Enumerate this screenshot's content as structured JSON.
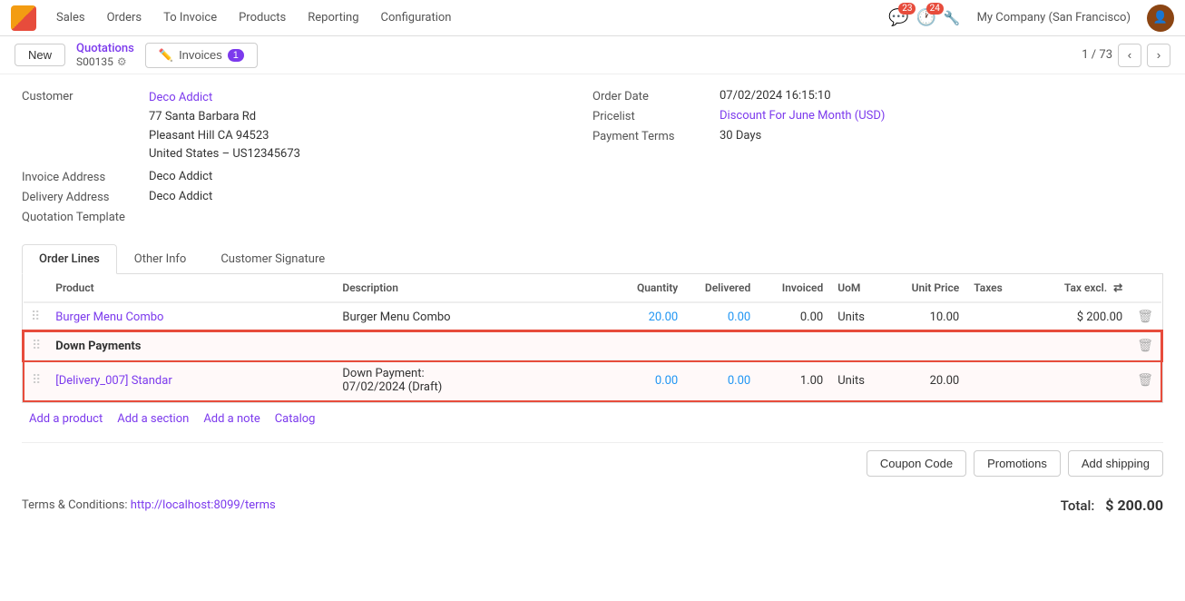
{
  "topnav": {
    "app_name": "Sales",
    "items": [
      "Orders",
      "To Invoice",
      "Products",
      "Reporting",
      "Configuration"
    ],
    "badge_msg": "23",
    "badge_clock": "24",
    "company": "My Company (San Francisco)"
  },
  "action_bar": {
    "new_label": "New",
    "breadcrumb_parent": "Quotations",
    "record_id": "S00135",
    "invoice_label": "Invoices",
    "invoice_count": "1",
    "pagination": "1 / 73"
  },
  "form": {
    "customer_label": "Customer",
    "customer_name": "Deco Addict",
    "customer_address1": "77 Santa Barbara Rd",
    "customer_address2": "Pleasant Hill CA 94523",
    "customer_address3": "United States – US12345673",
    "order_date_label": "Order Date",
    "order_date": "07/02/2024 16:15:10",
    "pricelist_label": "Pricelist",
    "pricelist_value": "Discount For June Month (USD)",
    "payment_terms_label": "Payment Terms",
    "payment_terms_value": "30 Days",
    "invoice_address_label": "Invoice Address",
    "invoice_address_value": "Deco Addict",
    "delivery_address_label": "Delivery Address",
    "delivery_address_value": "Deco Addict",
    "quotation_template_label": "Quotation Template"
  },
  "tabs": {
    "items": [
      "Order Lines",
      "Other Info",
      "Customer Signature"
    ],
    "active": 0
  },
  "table": {
    "headers": [
      "",
      "Product",
      "Description",
      "Quantity",
      "Delivered",
      "Invoiced",
      "UoM",
      "Unit Price",
      "Taxes",
      "Tax excl.",
      ""
    ],
    "rows": [
      {
        "type": "product",
        "product": "Burger Menu Combo",
        "description": "Burger Menu Combo",
        "quantity": "20.00",
        "delivered": "0.00",
        "invoiced": "0.00",
        "uom": "Units",
        "unit_price": "10.00",
        "taxes": "",
        "tax_excl": "$ 200.00"
      }
    ],
    "section_rows": [
      {
        "type": "section",
        "label": "Down Payments"
      }
    ],
    "down_payment_rows": [
      {
        "type": "product",
        "product": "[Delivery_007] Standar",
        "description": "Down Payment:\n07/02/2024 (Draft)",
        "quantity": "0.00",
        "delivered": "0.00",
        "invoiced": "1.00",
        "uom": "Units",
        "unit_price": "20.00",
        "taxes": "",
        "tax_excl": ""
      }
    ]
  },
  "add_links": {
    "add_product": "Add a product",
    "add_section": "Add a section",
    "add_note": "Add a note",
    "catalog": "Catalog"
  },
  "bottom": {
    "coupon_code": "Coupon Code",
    "promotions": "Promotions",
    "add_shipping": "Add shipping",
    "terms_label": "Terms & Conditions:",
    "terms_link": "http://localhost:8099/terms",
    "total_label": "Total:",
    "total_value": "$ 200.00"
  }
}
